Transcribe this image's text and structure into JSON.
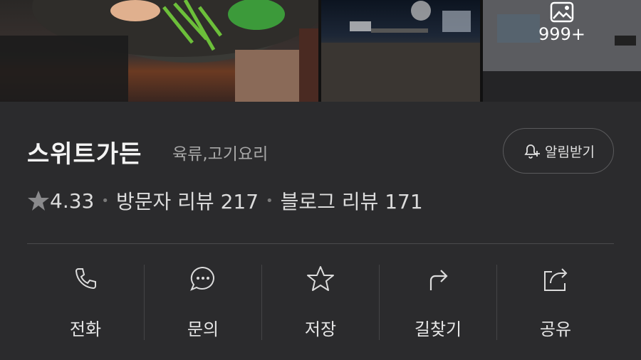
{
  "photos": {
    "more_count": "999+"
  },
  "place": {
    "name": "스위트가든",
    "category": "육류,고기요리"
  },
  "notify": {
    "label": "알림받기"
  },
  "rating": {
    "score": "4.33",
    "visitor_reviews": "방문자 리뷰 217",
    "blog_reviews": "블로그 리뷰 171"
  },
  "actions": [
    {
      "label": "전화",
      "icon": "phone-icon"
    },
    {
      "label": "문의",
      "icon": "chat-icon"
    },
    {
      "label": "저장",
      "icon": "star-icon"
    },
    {
      "label": "길찾기",
      "icon": "directions-icon"
    },
    {
      "label": "공유",
      "icon": "share-icon"
    }
  ],
  "colors": {
    "background": "#2b2b2d",
    "text": "#e8e8e8",
    "muted": "#a8a8a8"
  }
}
